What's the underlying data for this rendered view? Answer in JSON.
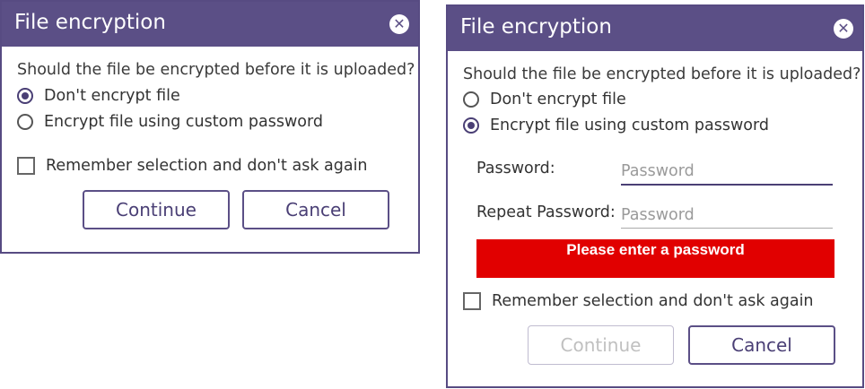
{
  "dialog_left": {
    "title": "File encryption",
    "close_glyph": "✕",
    "question": "Should the file be encrypted before it is uploaded?",
    "options": [
      {
        "label": "Don't encrypt file",
        "selected": true
      },
      {
        "label": "Encrypt file using custom password",
        "selected": false
      }
    ],
    "remember_label": "Remember selection and don't ask again",
    "remember_checked": false,
    "continue_label": "Continue",
    "continue_enabled": true,
    "cancel_label": "Cancel"
  },
  "dialog_right": {
    "title": "File encryption",
    "close_glyph": "✕",
    "question": "Should the file be encrypted before it is uploaded?",
    "options": [
      {
        "label": "Don't encrypt file",
        "selected": false
      },
      {
        "label": "Encrypt file using custom password",
        "selected": true
      }
    ],
    "password_label": "Password:",
    "password_placeholder": "Password",
    "password_value": "",
    "repeat_label": "Repeat Password:",
    "repeat_placeholder": "Password",
    "repeat_value": "",
    "error_message": "Please enter a password",
    "remember_label": "Remember selection and don't ask again",
    "remember_checked": false,
    "continue_label": "Continue",
    "continue_enabled": false,
    "cancel_label": "Cancel"
  },
  "colors": {
    "titlebar": "#5b4f86",
    "accent": "#4a3f75",
    "error": "#e10000"
  }
}
